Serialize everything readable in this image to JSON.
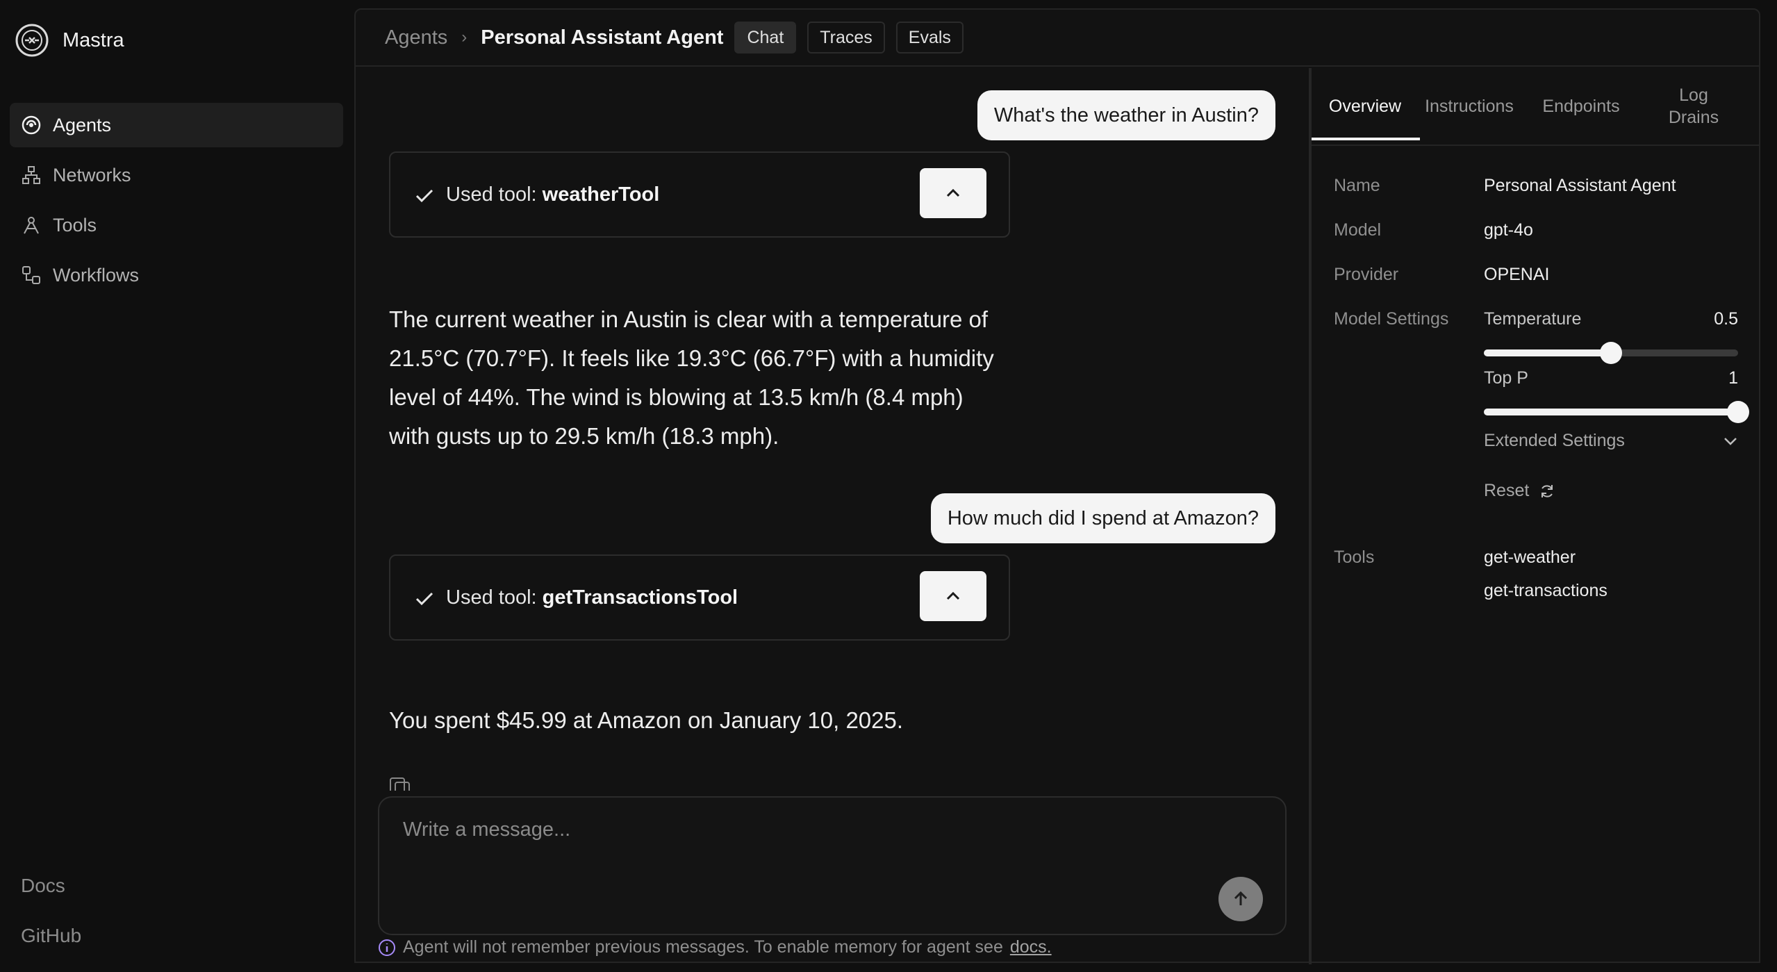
{
  "app": {
    "name": "Mastra"
  },
  "sidebar": {
    "items": [
      {
        "label": "Agents",
        "icon": "agents-icon"
      },
      {
        "label": "Networks",
        "icon": "networks-icon"
      },
      {
        "label": "Tools",
        "icon": "tools-icon"
      },
      {
        "label": "Workflows",
        "icon": "workflows-icon"
      }
    ],
    "footer": [
      "Docs",
      "GitHub"
    ]
  },
  "header": {
    "breadcrumb_root": "Agents",
    "breadcrumb_current": "Personal Assistant Agent",
    "tabs": [
      "Chat",
      "Traces",
      "Evals"
    ],
    "active_tab": "Chat"
  },
  "chat": {
    "messages": [
      {
        "role": "user",
        "text": "What's the weather in Austin?"
      },
      {
        "role": "tool",
        "prefix": "Used tool: ",
        "tool": "weatherTool"
      },
      {
        "role": "assistant",
        "lines": [
          "The current weather in Austin is clear with a temperature of",
          "21.5°C (70.7°F). It feels like 19.3°C (66.7°F) with a humidity",
          "level of 44%. The wind is blowing at 13.5 km/h (8.4 mph)",
          "with gusts up to 29.5 km/h (18.3 mph)."
        ]
      },
      {
        "role": "user",
        "text": "How much did I spend at Amazon?"
      },
      {
        "role": "tool",
        "prefix": "Used tool: ",
        "tool": "getTransactionsTool"
      },
      {
        "role": "assistant",
        "lines": [
          "You spent $45.99 at Amazon on January 10, 2025."
        ]
      }
    ],
    "composer_placeholder": "Write a message...",
    "memory_note": "Agent will not remember previous messages. To enable memory for agent see",
    "memory_link": "docs."
  },
  "panel": {
    "tabs": [
      "Overview",
      "Instructions",
      "Endpoints",
      "Log",
      "Drains"
    ],
    "active_tab": "Overview",
    "name_label": "Name",
    "name_value": "Personal Assistant Agent",
    "model_label": "Model",
    "model_value": "gpt-4o",
    "provider_label": "Provider",
    "provider_value": "OPENAI",
    "settings_label": "Model Settings",
    "temperature": {
      "label": "Temperature",
      "value": "0.5",
      "fraction": 0.5
    },
    "top_p": {
      "label": "Top P",
      "value": "1",
      "fraction": 1.0
    },
    "extended_label": "Extended Settings",
    "reset_label": "Reset",
    "tools_label": "Tools",
    "tools": [
      "get-weather",
      "get-transactions"
    ]
  }
}
